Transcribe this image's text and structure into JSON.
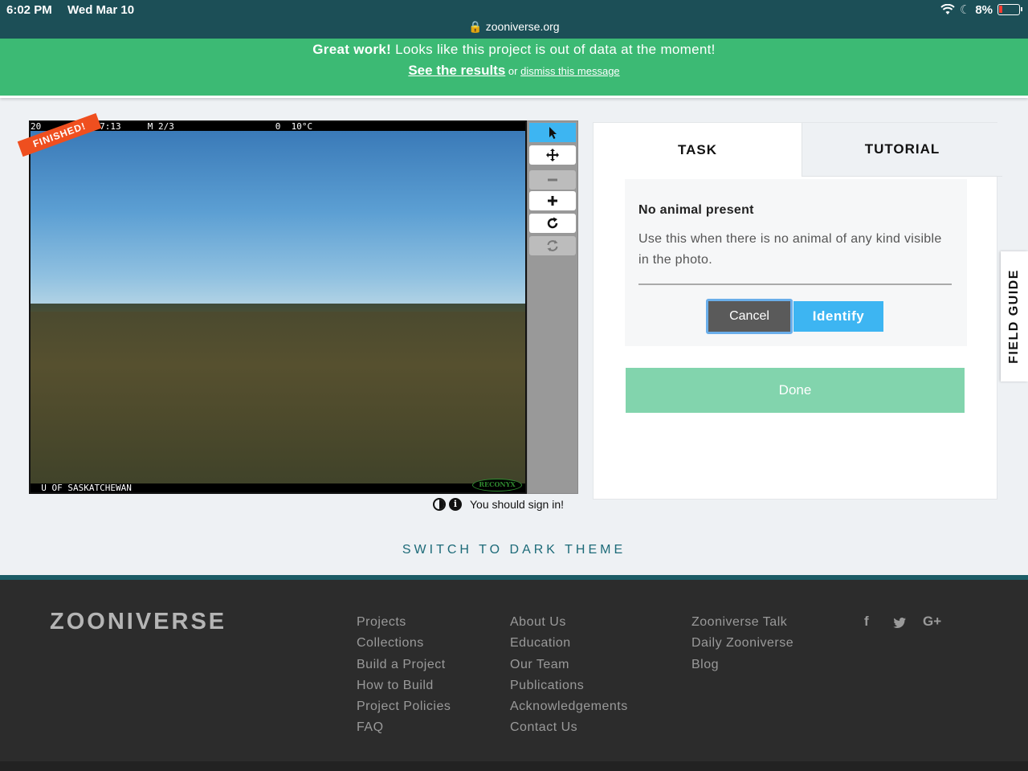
{
  "status_bar": {
    "time": "6:02 PM",
    "date": "Wed Mar 10",
    "url": "zooniverse.org",
    "battery": "8%"
  },
  "banner": {
    "bold": "Great work!",
    "message": "Looks like this project is out of data at the moment!",
    "results_link": "See the results",
    "or_text": "or",
    "dismiss_link": "dismiss this message"
  },
  "subject": {
    "top_date": "20",
    "top_time": "6 08:47:13",
    "top_m": "M 2/3",
    "top_zero": "0",
    "top_temp": "10°C",
    "bottom_label": "U OF SASKATCHEWAN",
    "camera_brand": "RECONYX",
    "finished_ribbon": "FINISHED!"
  },
  "viewer_meta": {
    "sign_in": "You should sign in!"
  },
  "task_panel": {
    "tabs": [
      {
        "label": "TASK"
      },
      {
        "label": "TUTORIAL"
      }
    ],
    "choice": {
      "title": "No animal present",
      "description": "Use this when there is no animal of any kind visible in the photo."
    },
    "cancel_label": "Cancel",
    "identify_label": "Identify",
    "done_label": "Done"
  },
  "field_guide_label": "FIELD GUIDE",
  "theme_switch_label": "SWITCH TO DARK THEME",
  "footer": {
    "logo": "ZOONIVERSE",
    "col1": [
      "Projects",
      "Collections",
      "Build a Project",
      "How to Build",
      "Project Policies",
      "FAQ"
    ],
    "col2": [
      "About Us",
      "Education",
      "Our Team",
      "Publications",
      "Acknowledgements",
      "Contact Us"
    ],
    "col3": [
      "Zooniverse Talk",
      "Daily Zooniverse",
      "Blog"
    ],
    "social": {
      "facebook": "f",
      "google": "G+"
    }
  },
  "colors": {
    "banner": "#3cba74",
    "accent_blue": "#3db5f2",
    "done_green": "#82d4ad",
    "ribbon": "#ef4f1f",
    "teal": "#1c6a78"
  }
}
